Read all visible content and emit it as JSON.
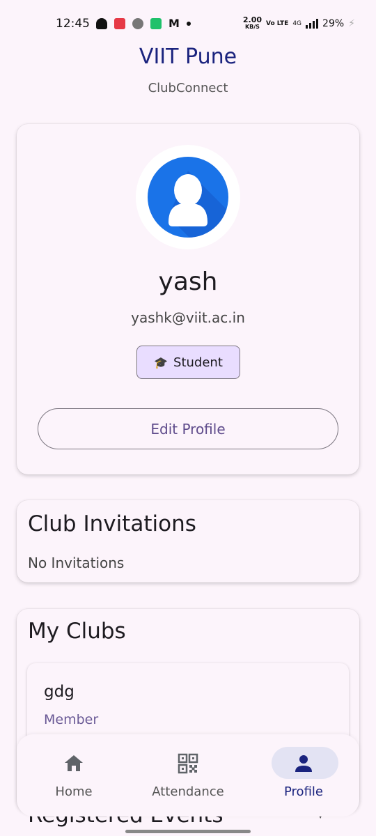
{
  "status_bar": {
    "time": "12:45",
    "speed_value": "2.00",
    "speed_unit": "KB/S",
    "volte": "Vo LTE",
    "network": "4G",
    "battery": "29%"
  },
  "header": {
    "title": "VIIT Pune",
    "subtitle": "ClubConnect"
  },
  "profile": {
    "name": "yash",
    "email": "yashk@viit.ac.in",
    "role_icon": "🎓",
    "role": "Student",
    "edit_label": "Edit Profile",
    "avatar_color": "#1a73e8"
  },
  "invitations": {
    "title": "Club Invitations",
    "empty_text": "No Invitations"
  },
  "clubs": {
    "title": "My Clubs",
    "items": [
      {
        "name": "gdg",
        "role": "Member"
      }
    ]
  },
  "events": {
    "title": "Registered Events"
  },
  "nav": {
    "items": [
      {
        "label": "Home",
        "icon": "home-icon"
      },
      {
        "label": "Attendance",
        "icon": "qr-code-icon"
      },
      {
        "label": "Profile",
        "icon": "person-icon",
        "active": true
      }
    ]
  },
  "colors": {
    "primary": "#1a237e",
    "accent": "#5e4b8b",
    "badge_bg": "#e9ddff",
    "background": "#fcf4fb"
  }
}
